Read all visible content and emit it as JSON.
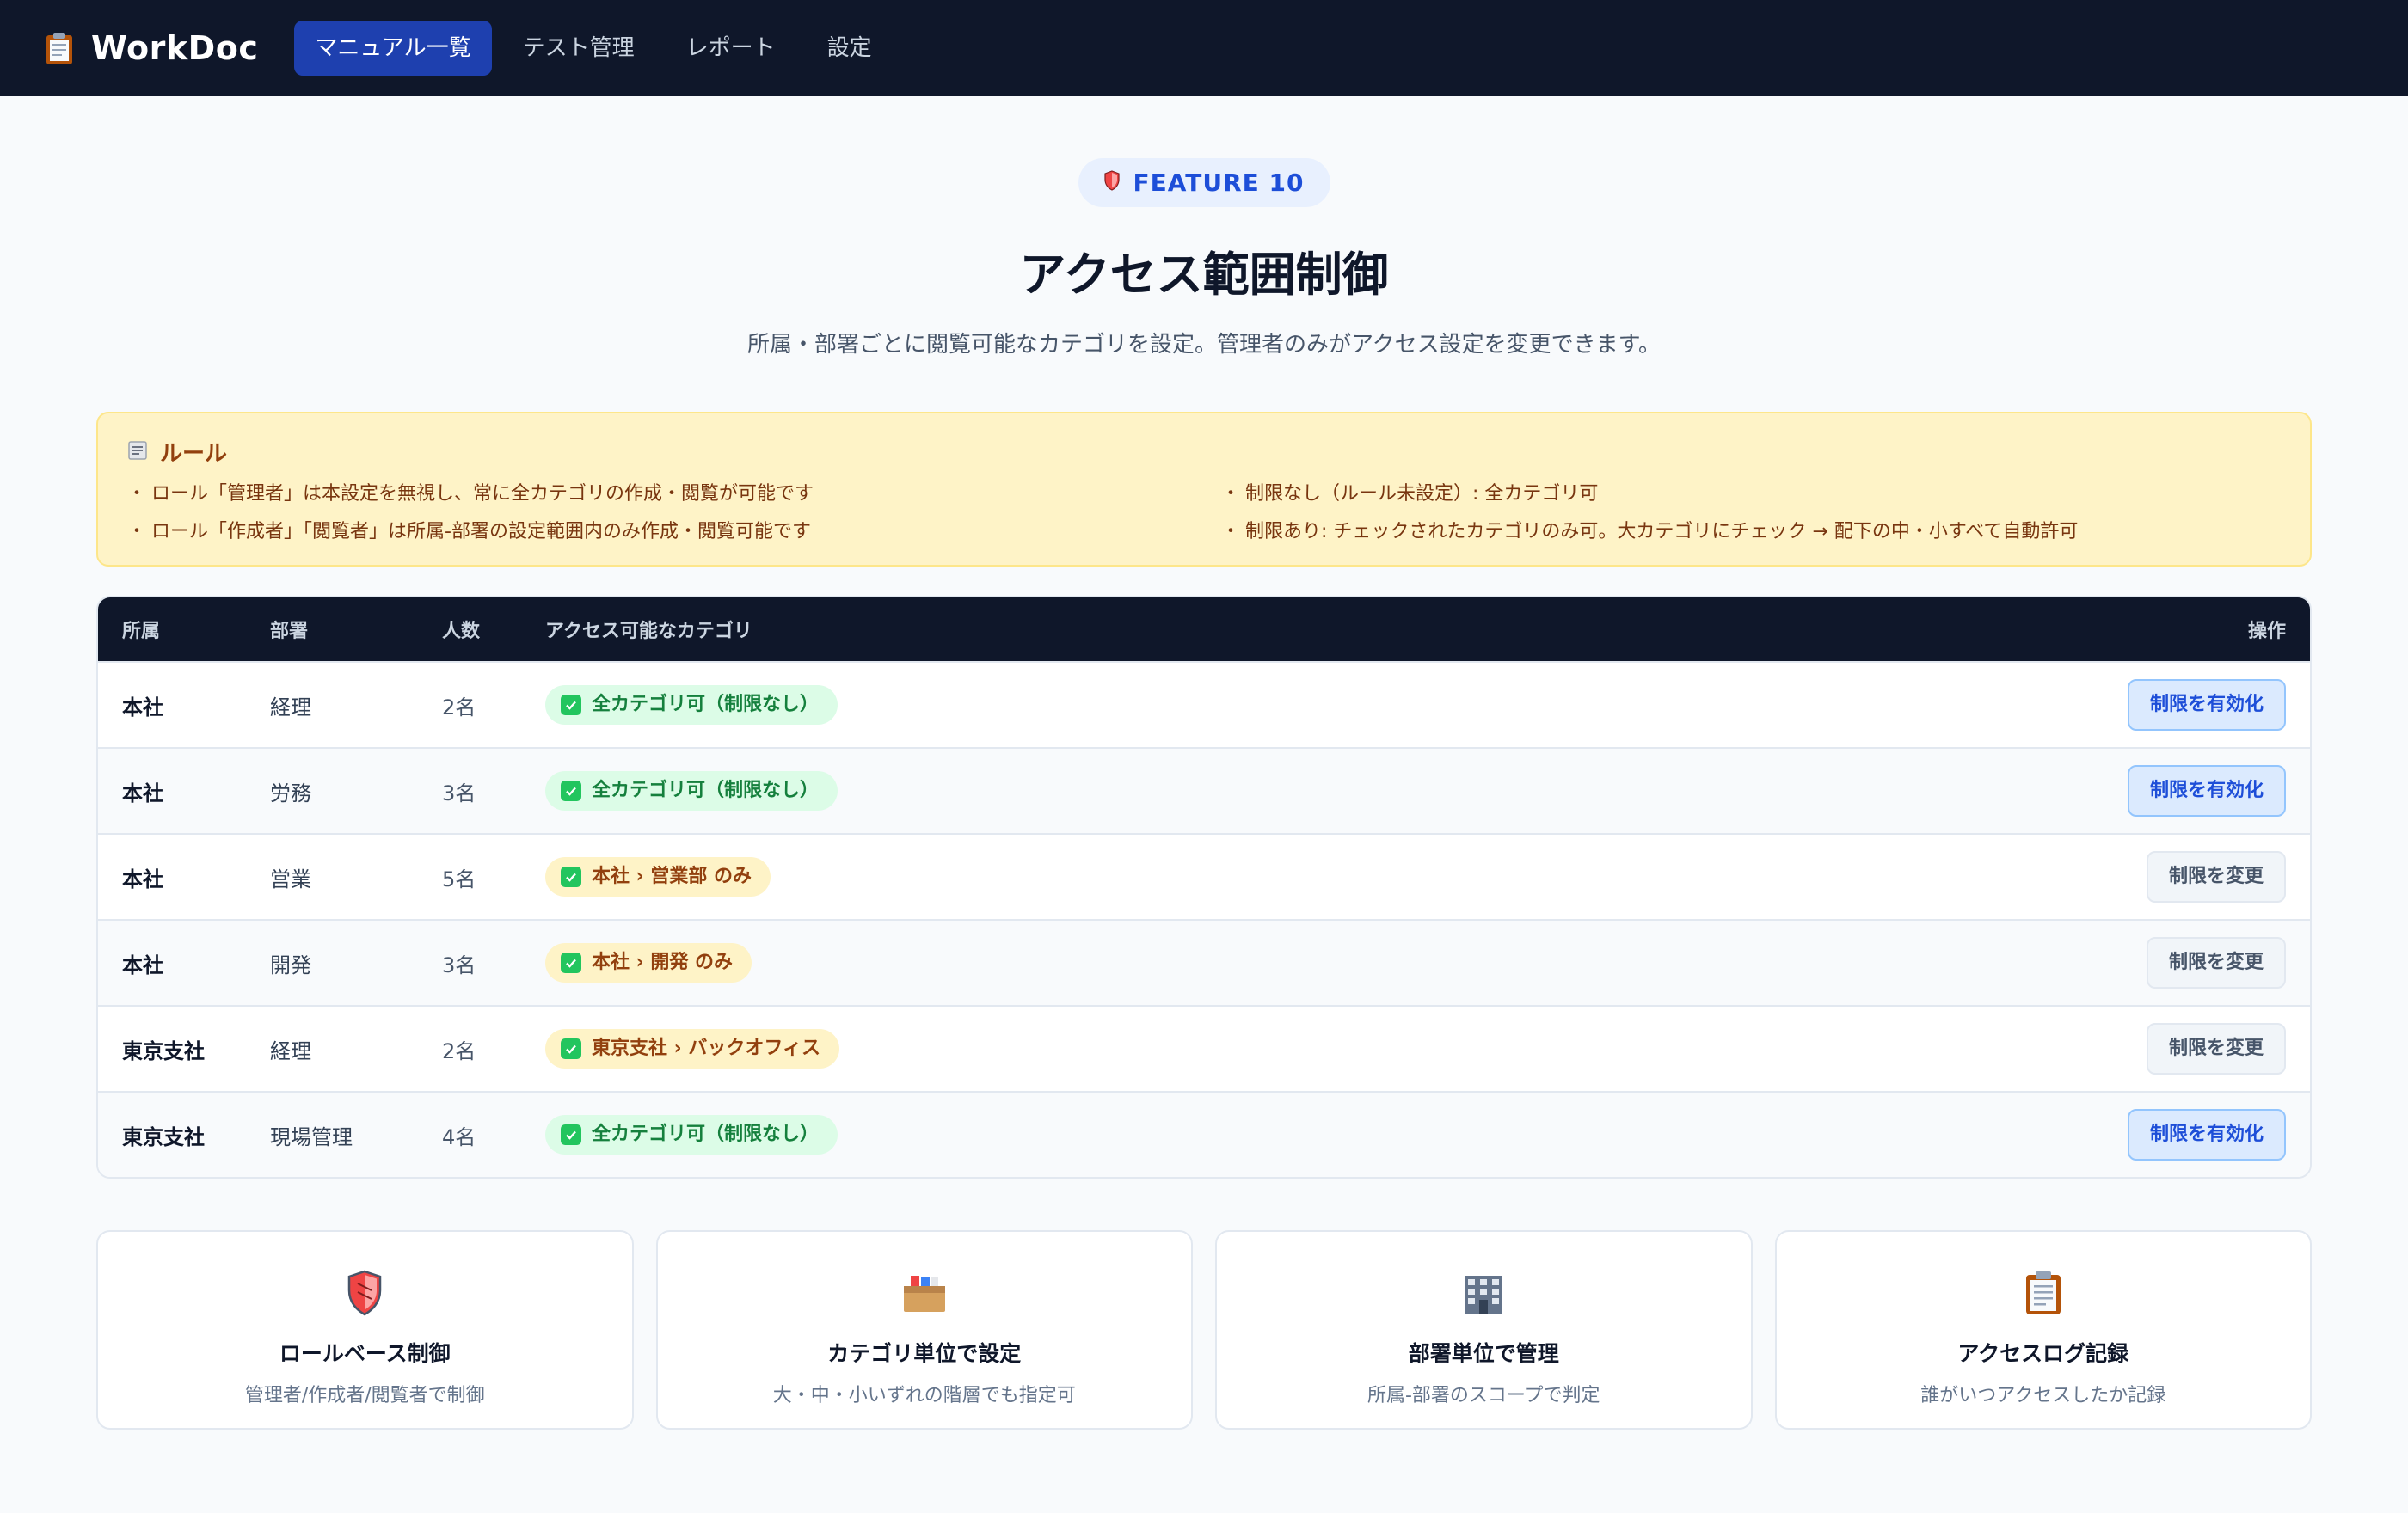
{
  "app": {
    "name": "WorkDoc",
    "nav": [
      {
        "label": "マニュアル一覧",
        "active": true
      },
      {
        "label": "テスト管理",
        "active": false
      },
      {
        "label": "レポート",
        "active": false
      },
      {
        "label": "設定",
        "active": false
      }
    ]
  },
  "hero": {
    "badge": "FEATURE 10",
    "title": "アクセス範囲制御",
    "subtitle": "所属・部署ごとに閲覧可能なカテゴリを設定。管理者のみがアクセス設定を変更できます。"
  },
  "rules": {
    "title": "ルール",
    "items": [
      "ロール「管理者」は本設定を無視し、常に全カテゴリの作成・閲覧が可能です",
      "制限なし（ルール未設定）: 全カテゴリ可",
      "ロール「作成者」「閲覧者」は所属-部署の設定範囲内のみ作成・閲覧可能です",
      "制限あり: チェックされたカテゴリのみ可。大カテゴリにチェック → 配下の中・小すべて自動許可"
    ]
  },
  "table": {
    "headers": {
      "affiliation": "所属",
      "department": "部署",
      "count": "人数",
      "categories": "アクセス可能なカテゴリ",
      "actions": "操作"
    },
    "rows": [
      {
        "affiliation": "本社",
        "department": "経理",
        "count": "2名",
        "category": "全カテゴリ可（制限なし）",
        "badge": "green",
        "action": "制限を有効化",
        "action_style": "primary"
      },
      {
        "affiliation": "本社",
        "department": "労務",
        "count": "3名",
        "category": "全カテゴリ可（制限なし）",
        "badge": "green",
        "action": "制限を有効化",
        "action_style": "primary"
      },
      {
        "affiliation": "本社",
        "department": "営業",
        "count": "5名",
        "category": "本社 › 営業部 のみ",
        "badge": "amber",
        "action": "制限を変更",
        "action_style": "secondary"
      },
      {
        "affiliation": "本社",
        "department": "開発",
        "count": "3名",
        "category": "本社 › 開発 のみ",
        "badge": "amber",
        "action": "制限を変更",
        "action_style": "secondary"
      },
      {
        "affiliation": "東京支社",
        "department": "経理",
        "count": "2名",
        "category": "東京支社 › バックオフィス",
        "badge": "amber",
        "action": "制限を変更",
        "action_style": "secondary"
      },
      {
        "affiliation": "東京支社",
        "department": "現場管理",
        "count": "4名",
        "category": "全カテゴリ可（制限なし）",
        "badge": "green",
        "action": "制限を有効化",
        "action_style": "primary"
      }
    ]
  },
  "features": [
    {
      "icon": "shield-icon",
      "title": "ロールベース制御",
      "desc": "管理者/作成者/閲覧者で制御"
    },
    {
      "icon": "card-file-box-icon",
      "title": "カテゴリ単位で設定",
      "desc": "大・中・小いずれの階層でも指定可"
    },
    {
      "icon": "office-building-icon",
      "title": "部署単位で管理",
      "desc": "所属-部署のスコープで判定"
    },
    {
      "icon": "clipboard-icon",
      "title": "アクセスログ記録",
      "desc": "誰がいつアクセスしたか記録"
    }
  ],
  "colors": {
    "nav_bg": "#0f172a",
    "accent": "#1d4ed8",
    "rules_bg": "#fef3c7",
    "badge_green": "#dcfce7",
    "badge_amber": "#fef3c7"
  }
}
